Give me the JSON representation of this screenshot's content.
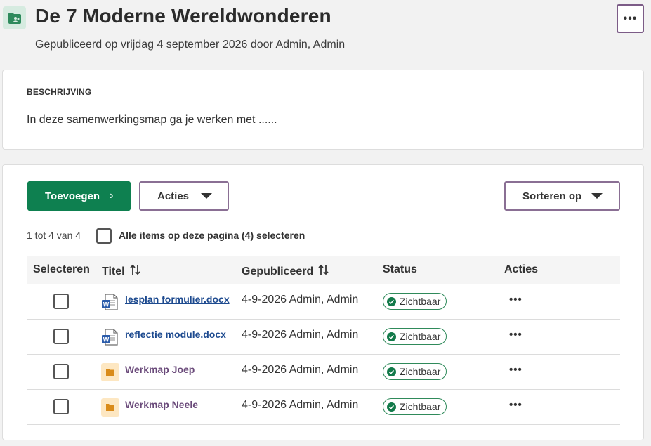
{
  "header": {
    "title": "De 7 Moderne Wereldwonderen",
    "subtitle": "Gepubliceerd op vrijdag 4 september 2026 door Admin, Admin",
    "more_label": "•••",
    "icon": "shared-folder-icon"
  },
  "description": {
    "label": "BESCHRIJVING",
    "text": "In deze samenwerkingsmap ga je werken met ......"
  },
  "toolbar": {
    "add_label": "Toevoegen",
    "add_chevron": "›",
    "actions_label": "Acties",
    "sort_label": "Sorteren op"
  },
  "selection": {
    "count_text": "1 tot 4 van 4",
    "select_all_label": "Alle items op deze pagina (4) selecteren"
  },
  "table": {
    "columns": {
      "select": "Selecteren",
      "title": "Titel",
      "published": "Gepubliceerd",
      "status": "Status",
      "actions": "Acties"
    },
    "rows": [
      {
        "type": "word-doc",
        "title": "lesplan formulier.docx",
        "published": "4-9-2026 Admin, Admin",
        "status": "Zichtbaar",
        "actions": "•••"
      },
      {
        "type": "word-doc",
        "title": "reflectie module.docx",
        "published": "4-9-2026 Admin, Admin",
        "status": "Zichtbaar",
        "actions": "•••"
      },
      {
        "type": "folder",
        "title": "Werkmap Joep",
        "published": "4-9-2026 Admin, Admin",
        "status": "Zichtbaar",
        "actions": "•••"
      },
      {
        "type": "folder",
        "title": "Werkmap Neele",
        "published": "4-9-2026 Admin, Admin",
        "status": "Zichtbaar",
        "actions": "•••"
      }
    ]
  },
  "colors": {
    "primary_green": "#0e8050",
    "outline_purple": "#8a6f94",
    "status_green": "#137a4a",
    "doc_link": "#1d4a8f",
    "folder_link": "#6a4a7a",
    "folder_icon": "#d98b1a"
  }
}
